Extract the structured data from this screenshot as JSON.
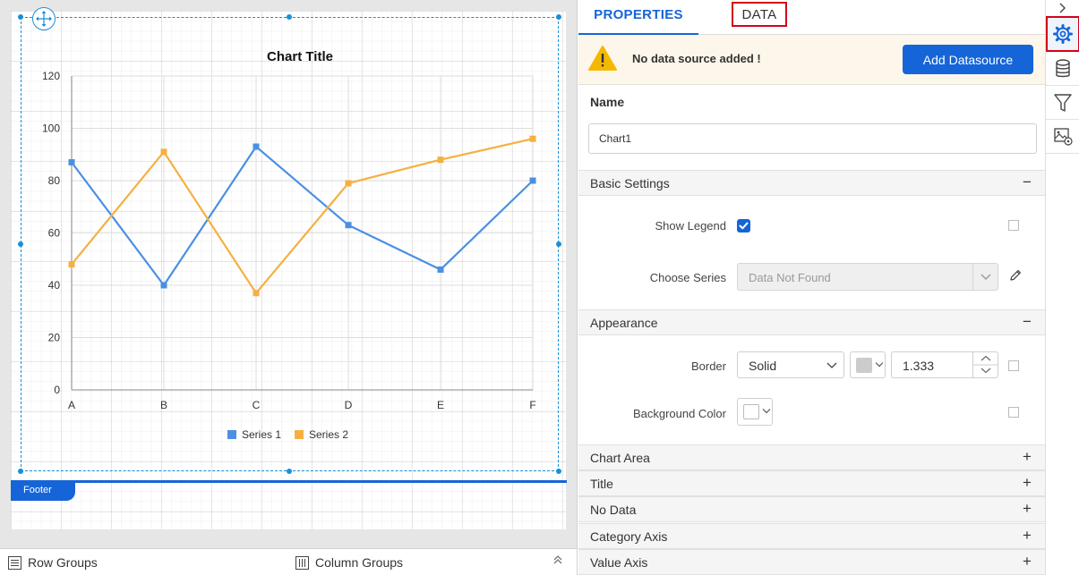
{
  "canvas": {
    "footer_label": "Footer"
  },
  "groups_bar": {
    "row_groups": "Row Groups",
    "column_groups": "Column Groups"
  },
  "panel": {
    "tabs": {
      "properties": "PROPERTIES",
      "data": "DATA"
    },
    "warning": {
      "text": "No data source added !",
      "button": "Add Datasource"
    },
    "name": {
      "label": "Name",
      "value": "Chart1"
    },
    "basic_settings": {
      "title": "Basic Settings",
      "toggle": "−",
      "show_legend_label": "Show Legend",
      "show_legend_checked": true,
      "choose_series_label": "Choose Series",
      "choose_series_placeholder": "Data Not Found"
    },
    "appearance": {
      "title": "Appearance",
      "toggle": "−",
      "border_label": "Border",
      "border_style": "Solid",
      "border_color": "#cccccc",
      "border_width": "1.333",
      "background_label": "Background Color",
      "background_color": "#ffffff"
    },
    "collapsed_sections": [
      {
        "title": "Chart Area",
        "toggle": "+"
      },
      {
        "title": "Title",
        "toggle": "+"
      },
      {
        "title": "No Data",
        "toggle": "+"
      },
      {
        "title": "Category Axis",
        "toggle": "+"
      },
      {
        "title": "Value Axis",
        "toggle": "+"
      }
    ]
  },
  "rail": {
    "items": [
      "chevron-right-icon",
      "gear-icon",
      "database-icon",
      "filter-icon",
      "image-settings-icon"
    ],
    "chevron": "›"
  },
  "colors": {
    "accent": "#1565d8",
    "highlight": "#d0021b",
    "warning_bg": "#fdf6ea",
    "series_1": "#4a90e2",
    "series_2": "#f5b041"
  },
  "chart_data": {
    "type": "line",
    "title": "Chart Title",
    "categories": [
      "A",
      "B",
      "C",
      "D",
      "E",
      "F"
    ],
    "series": [
      {
        "name": "Series 1",
        "values": [
          87,
          40,
          93,
          63,
          46,
          80
        ]
      },
      {
        "name": "Series 2",
        "values": [
          48,
          91,
          37,
          79,
          88,
          96
        ]
      }
    ],
    "ylim": [
      0,
      120
    ],
    "yticks": [
      0,
      20,
      40,
      60,
      80,
      100,
      120
    ],
    "grid": true,
    "legend_position": "bottom"
  }
}
